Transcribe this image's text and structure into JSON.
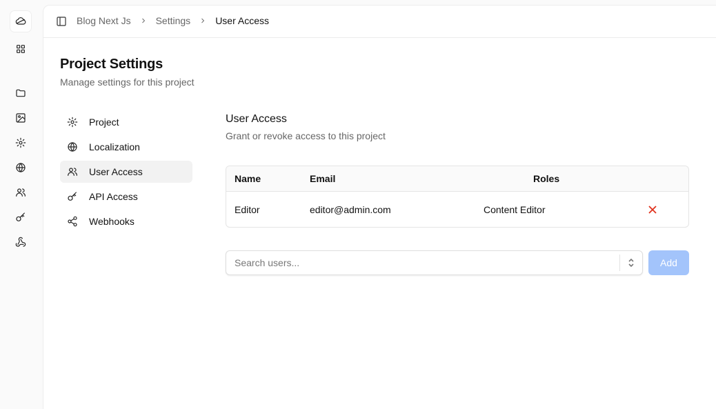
{
  "rail": {
    "items": [
      {
        "icon": "cloud-logo-icon"
      },
      {
        "icon": "grid-icon"
      },
      {
        "icon": "folder-icon"
      },
      {
        "icon": "image-icon"
      },
      {
        "icon": "gear-icon"
      },
      {
        "icon": "globe-icon"
      },
      {
        "icon": "users-icon"
      },
      {
        "icon": "key-icon"
      },
      {
        "icon": "webhook-icon"
      }
    ]
  },
  "breadcrumb": {
    "items": [
      "Blog Next Js",
      "Settings",
      "User Access"
    ]
  },
  "page": {
    "title": "Project Settings",
    "subtitle": "Manage settings for this project"
  },
  "settings_nav": {
    "items": [
      {
        "label": "Project",
        "icon": "gear-icon"
      },
      {
        "label": "Localization",
        "icon": "globe-icon"
      },
      {
        "label": "User Access",
        "icon": "users-icon",
        "active": true
      },
      {
        "label": "API Access",
        "icon": "key-icon"
      },
      {
        "label": "Webhooks",
        "icon": "share-icon"
      }
    ]
  },
  "section": {
    "title": "User Access",
    "subtitle": "Grant or revoke access to this project"
  },
  "table": {
    "headers": {
      "name": "Name",
      "email": "Email",
      "roles": "Roles"
    },
    "rows": [
      {
        "name": "Editor",
        "email": "editor@admin.com",
        "role": "Content Editor"
      }
    ]
  },
  "search": {
    "placeholder": "Search users...",
    "value": ""
  },
  "add_button": {
    "label": "Add"
  },
  "colors": {
    "accent_disabled": "#a3c4fb",
    "danger": "#e0321d"
  }
}
